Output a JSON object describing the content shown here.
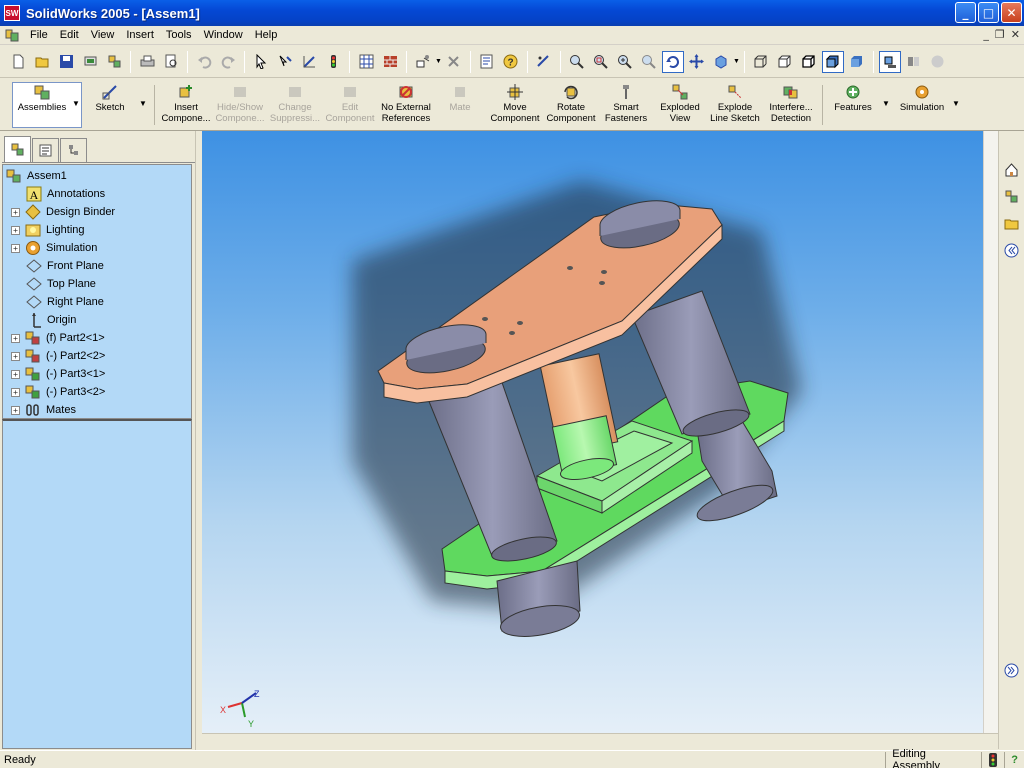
{
  "window": {
    "app_logo": "SW",
    "title": "SolidWorks 2005 - [Assem1]",
    "controls": [
      "minimize",
      "maximize",
      "close"
    ]
  },
  "menu": {
    "items": [
      "File",
      "Edit",
      "View",
      "Insert",
      "Tools",
      "Window",
      "Help"
    ]
  },
  "standard_toolbar": {
    "icons": [
      "new-icon",
      "open-icon",
      "save-icon",
      "print-icon",
      "print-preview-icon",
      "undo-icon",
      "redo-icon",
      "select-icon",
      "rebuild-icon",
      "options-icon",
      "help-icon",
      "zoom-to-fit-icon",
      "zoom-area-icon",
      "zoom-in-out-icon",
      "rotate-icon",
      "pan-icon",
      "view-orientation-icon",
      "wireframe-icon",
      "hidden-lines-icon",
      "shaded-icon"
    ]
  },
  "command_manager": {
    "tabs": [
      {
        "label": "Assemblies"
      },
      {
        "label": "Sketch"
      }
    ],
    "buttons": [
      {
        "label": "Insert\nCompone...",
        "enabled": true
      },
      {
        "label": "Hide/Show\nCompone...",
        "enabled": false
      },
      {
        "label": "Change\nSuppressi...",
        "enabled": false
      },
      {
        "label": "Edit\nComponent",
        "enabled": false
      },
      {
        "label": "No External\nReferences",
        "enabled": true
      },
      {
        "label": "Mate",
        "enabled": false
      },
      {
        "label": "Move\nComponent",
        "enabled": true
      },
      {
        "label": "Rotate\nComponent",
        "enabled": true
      },
      {
        "label": "Smart\nFasteners",
        "enabled": true
      },
      {
        "label": "Exploded\nView",
        "enabled": true
      },
      {
        "label": "Explode\nLine Sketch",
        "enabled": true
      },
      {
        "label": "Interfere...\nDetection",
        "enabled": true
      },
      {
        "label": "Features",
        "enabled": true
      },
      {
        "label": "Simulation",
        "enabled": true
      }
    ]
  },
  "feature_tree": {
    "root": "Assem1",
    "items": [
      {
        "label": "Annotations",
        "expandable": false,
        "icon": "annotations-icon"
      },
      {
        "label": "Design Binder",
        "expandable": true,
        "icon": "design-binder-icon"
      },
      {
        "label": "Lighting",
        "expandable": true,
        "icon": "lighting-icon"
      },
      {
        "label": "Simulation",
        "expandable": true,
        "icon": "simulation-icon"
      },
      {
        "label": "Front Plane",
        "expandable": false,
        "icon": "plane-icon"
      },
      {
        "label": "Top Plane",
        "expandable": false,
        "icon": "plane-icon"
      },
      {
        "label": "Right Plane",
        "expandable": false,
        "icon": "plane-icon"
      },
      {
        "label": "Origin",
        "expandable": false,
        "icon": "origin-icon"
      },
      {
        "label": "(f) Part2<1>",
        "expandable": true,
        "icon": "part-icon"
      },
      {
        "label": "(-) Part2<2>",
        "expandable": true,
        "icon": "part-icon"
      },
      {
        "label": "(-) Part3<1>",
        "expandable": true,
        "icon": "part-icon"
      },
      {
        "label": "(-) Part3<2>",
        "expandable": true,
        "icon": "part-icon"
      },
      {
        "label": "Mates",
        "expandable": true,
        "icon": "mates-icon"
      }
    ]
  },
  "triad": {
    "x": "X",
    "y": "Y",
    "z": "Z"
  },
  "status": {
    "left": "Ready",
    "mode": "Editing Assembly",
    "help": "?"
  },
  "colors": {
    "top_plate": "#e8a07a",
    "bottom_plate": "#7deb7d",
    "columns": "#8a8ca8",
    "viewport_top": "#3e91e3",
    "viewport_bottom": "#e5eff8"
  }
}
